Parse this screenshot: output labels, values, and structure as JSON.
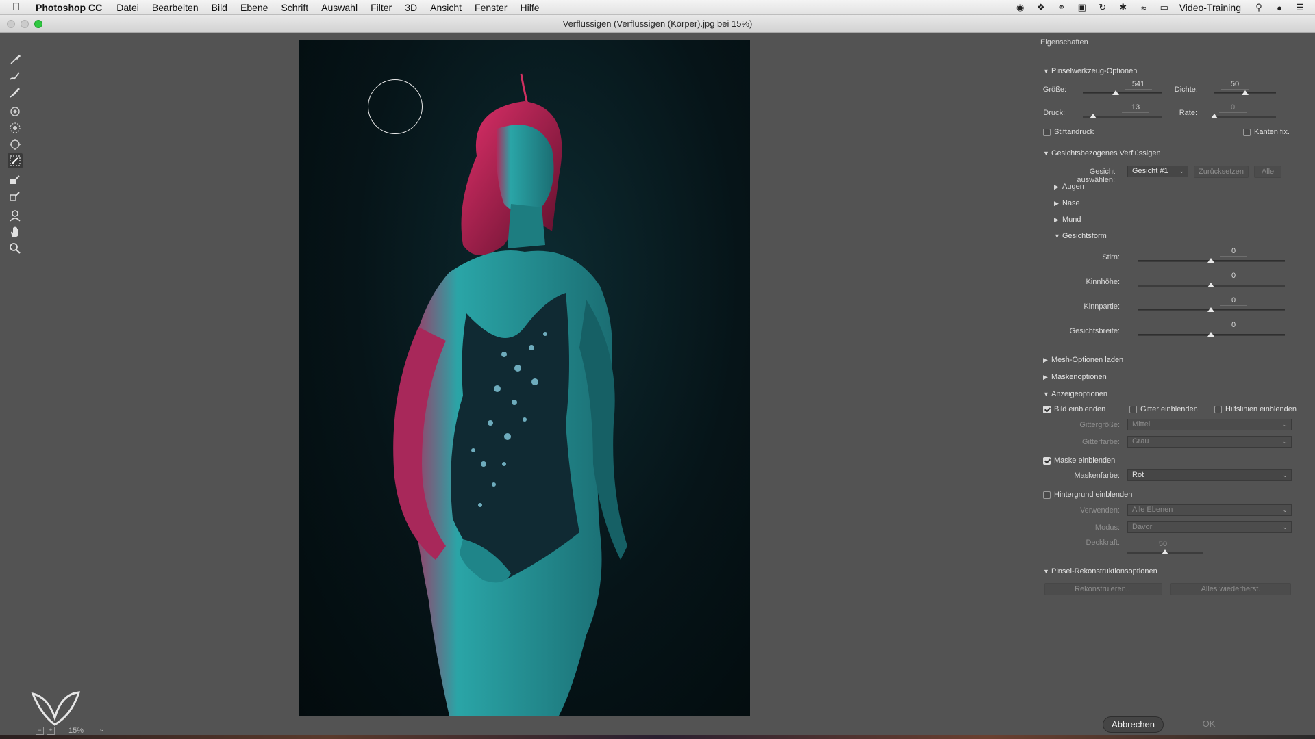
{
  "menubar": {
    "app_name": "Photoshop CC",
    "items": [
      "Datei",
      "Bearbeiten",
      "Bild",
      "Ebene",
      "Schrift",
      "Auswahl",
      "Filter",
      "3D",
      "Ansicht",
      "Fenster",
      "Hilfe"
    ],
    "user": "Video-Training"
  },
  "window": {
    "title": "Verflüssigen (Verflüssigen (Körper).jpg bei 15%)"
  },
  "status": {
    "zoom": "15%"
  },
  "panel": {
    "header": "Eigenschaften",
    "brush_section": "Pinselwerkzeug-Optionen",
    "size_label": "Größe:",
    "size_value": "541",
    "size_level": 0.42,
    "density_label": "Dichte:",
    "density_value": "50",
    "density_level": 0.5,
    "pressure_label": "Druck:",
    "pressure_value": "13",
    "pressure_level": 0.13,
    "rate_label": "Rate:",
    "rate_value": "0",
    "rate_level": 0.0,
    "stylus_label": "Stiftandruck",
    "pin_edges_label": "Kanten fix.",
    "face_section": "Gesichtsbezogenes Verflüssigen",
    "select_face_label": "Gesicht auswählen:",
    "select_face_value": "Gesicht #1",
    "reset_label": "Zurücksetzen",
    "all_label": "Alle",
    "eyes_label": "Augen",
    "nose_label": "Nase",
    "mouth_label": "Mund",
    "face_shape_label": "Gesichtsform",
    "forehead_label": "Stirn:",
    "forehead_value": "0",
    "chin_height_label": "Kinnhöhe:",
    "chin_height_value": "0",
    "jawline_label": "Kinnpartie:",
    "jawline_value": "0",
    "face_width_label": "Gesichtsbreite:",
    "face_width_value": "0",
    "mesh_section": "Mesh-Optionen laden",
    "mask_section": "Maskenoptionen",
    "view_section": "Anzeigeoptionen",
    "show_image_label": "Bild einblenden",
    "show_mesh_label": "Gitter einblenden",
    "show_guides_label": "Hilfslinien einblenden",
    "mesh_size_label": "Gittergröße:",
    "mesh_size_value": "Mittel",
    "mesh_color_label": "Gitterfarbe:",
    "mesh_color_value": "Grau",
    "show_mask_label": "Maske einblenden",
    "mask_color_label": "Maskenfarbe:",
    "mask_color_value": "Rot",
    "show_backdrop_label": "Hintergrund einblenden",
    "use_label": "Verwenden:",
    "use_value": "Alle Ebenen",
    "mode_label": "Modus:",
    "mode_value": "Davor",
    "opacity_label": "Deckkraft:",
    "opacity_value": "50",
    "opacity_level": 0.5,
    "reconstruct_section": "Pinsel-Rekonstruktionsoptionen",
    "reconstruct_button": "Rekonstruieren...",
    "restore_all_button": "Alles wiederherst.",
    "cancel_button": "Abbrechen",
    "ok_button": "OK"
  },
  "colors": {
    "traffic_close": "#c8c8c8",
    "traffic_min": "#c8c8c8",
    "traffic_max": "#2fc840",
    "teal_skin": "#2aa5a7",
    "magenta_light": "#e0306a"
  }
}
